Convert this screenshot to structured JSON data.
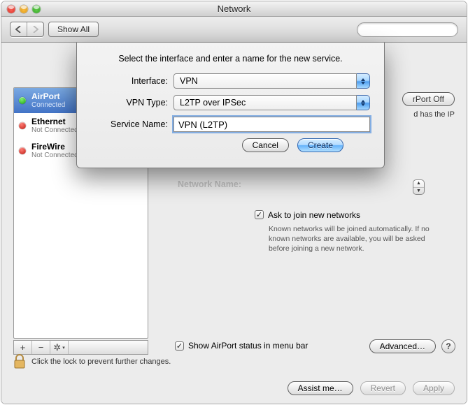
{
  "window": {
    "title": "Network"
  },
  "toolbar": {
    "show_all": "Show All",
    "search_placeholder": ""
  },
  "sidebar": {
    "items": [
      {
        "name": "AirPort",
        "status": "Connected",
        "dot": "green",
        "selected": true
      },
      {
        "name": "Ethernet",
        "status": "Not Connected",
        "dot": "red",
        "selected": false
      },
      {
        "name": "FireWire",
        "status": "Not Connected",
        "dot": "red",
        "selected": false
      }
    ]
  },
  "right_panel": {
    "turn_off_btn": "rPort Off",
    "status_tail": "d has the IP",
    "network_name_label": "Network Name:",
    "ask_checkbox": "Ask to join new networks",
    "ask_hint": "Known networks will be joined automatically. If no known networks are available, you will be asked before joining a new network.",
    "show_status": "Show AirPort status in menu bar",
    "advanced": "Advanced…",
    "lock_text": "Click the lock to prevent further changes.",
    "assist": "Assist me…",
    "revert": "Revert",
    "apply": "Apply"
  },
  "sheet": {
    "heading": "Select the interface and enter a name for the new service.",
    "labels": {
      "interface": "Interface:",
      "vpn_type": "VPN Type:",
      "service_name": "Service Name:"
    },
    "values": {
      "interface": "VPN",
      "vpn_type": "L2TP over IPSec",
      "service_name": "VPN (L2TP)"
    },
    "cancel": "Cancel",
    "create": "Create"
  }
}
